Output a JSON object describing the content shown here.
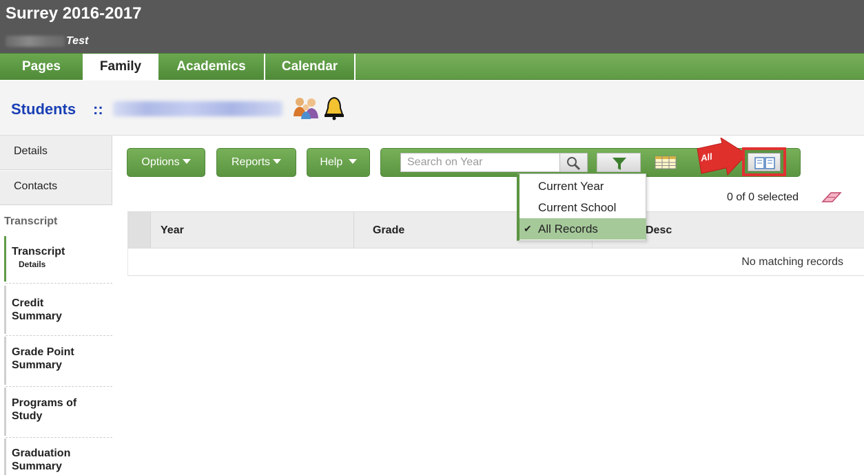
{
  "header": {
    "title": "Surrey 2016-2017",
    "user_label": "Test"
  },
  "tabs": [
    {
      "label": "Pages",
      "active": false
    },
    {
      "label": "Family",
      "active": true
    },
    {
      "label": "Academics",
      "active": false
    },
    {
      "label": "Calendar",
      "active": false
    }
  ],
  "breadcrumb": {
    "section": "Students",
    "separator": "::"
  },
  "sidenav": {
    "top_items": [
      "Details",
      "Contacts"
    ],
    "section_label": "Transcript",
    "items": [
      {
        "label": "Transcript",
        "sub": "Details",
        "active": true
      },
      {
        "label": "Credit Summary"
      },
      {
        "label": "Grade Point Summary"
      },
      {
        "label": "Programs of Study"
      },
      {
        "label": "Graduation Summary"
      }
    ]
  },
  "toolbar": {
    "options_label": "Options",
    "reports_label": "Reports",
    "help_label": "Help",
    "search_placeholder": "Search on Year",
    "callout_label": "All"
  },
  "filter_menu": {
    "items": [
      {
        "label": "Current Year",
        "selected": false
      },
      {
        "label": "Current School",
        "selected": false
      },
      {
        "label": "All Records",
        "selected": true
      }
    ]
  },
  "selection": {
    "count_text": "0 of 0 selected"
  },
  "table": {
    "columns": [
      "Year",
      "Grade",
      "Desc"
    ],
    "empty_text": "No matching records"
  },
  "colors": {
    "header_bg": "#585858",
    "tab_green": "#5f9a44",
    "link_blue": "#1a3fb4",
    "highlight_red": "#e03131",
    "selected_row": "#a6c99a"
  },
  "icons": [
    "family-icon",
    "bell-icon",
    "search-icon",
    "filter-icon",
    "grid-icon",
    "book-icon",
    "eraser-icon",
    "check-icon"
  ]
}
